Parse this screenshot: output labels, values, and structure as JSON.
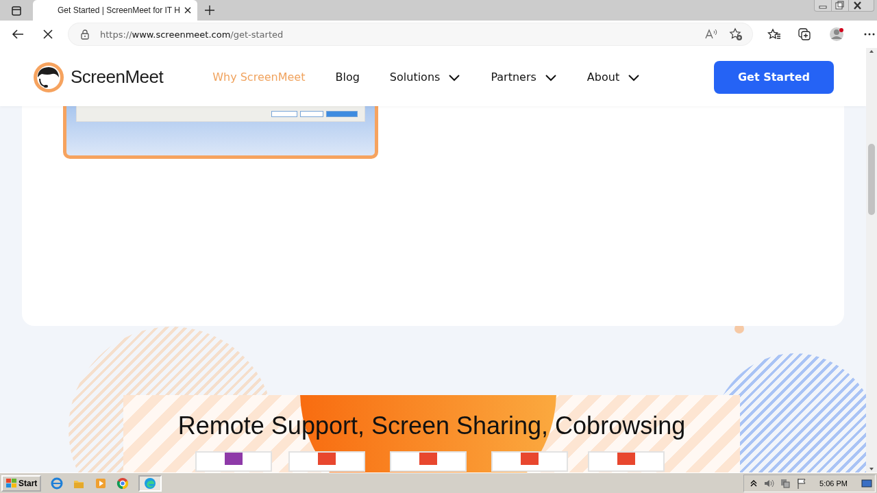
{
  "browser": {
    "tabs": [
      {
        "title": "Get Started | ScreenMeet for IT H",
        "selected": true
      }
    ],
    "address": {
      "scheme": "https://",
      "host": "www.screenmeet.com",
      "path": "/get-started"
    }
  },
  "site": {
    "logo": "ScreenMeet",
    "nav": [
      {
        "label": "Why ScreenMeet",
        "selected": true,
        "dropdown": false
      },
      {
        "label": "Blog",
        "selected": false,
        "dropdown": false
      },
      {
        "label": "Solutions",
        "selected": false,
        "dropdown": true
      },
      {
        "label": "Partners",
        "selected": false,
        "dropdown": true
      },
      {
        "label": "About",
        "selected": false,
        "dropdown": true
      }
    ],
    "cta": "Get Started"
  },
  "banner": {
    "heading": "Remote Support, Screen Sharing, Cobrowsing",
    "badges": [
      {
        "color": "#8e3aa8"
      },
      {
        "color": "#e8472e"
      },
      {
        "color": "#e8472e"
      },
      {
        "color": "#e8472e"
      },
      {
        "color": "#e8472e"
      }
    ]
  },
  "taskbar": {
    "start": "Start",
    "clock": "5:06 PM"
  }
}
